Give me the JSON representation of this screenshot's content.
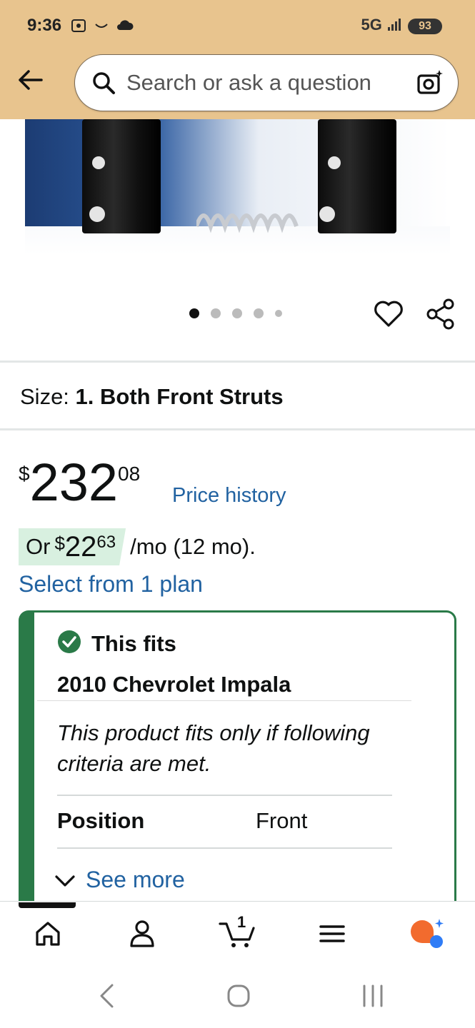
{
  "status_bar": {
    "time": "9:36",
    "network": "5G",
    "battery": "93"
  },
  "header": {
    "search_placeholder": "Search or ask a question"
  },
  "product": {
    "image_dots": {
      "count": 5,
      "active_index": 0
    },
    "size_label": "Size:",
    "size_value": "1. Both Front Struts",
    "price": {
      "currency": "$",
      "whole": "232",
      "fraction": "08",
      "history_link": "Price history"
    },
    "monthly": {
      "or": "Or",
      "currency": "$",
      "whole": "22",
      "fraction": "63",
      "rest": "/mo (12 mo)."
    },
    "select_plan": "Select from 1 plan"
  },
  "fit": {
    "title": "This fits",
    "vehicle": "2010 Chevrolet Impala",
    "criteria_text": "This product fits only if following criteria are met.",
    "position_label": "Position",
    "position_value": "Front",
    "see_more": "See more"
  },
  "bottom_nav": {
    "cart_count": "1",
    "items": [
      "home-icon",
      "account-icon",
      "cart-icon",
      "menu-icon",
      "rufus-icon"
    ]
  },
  "colors": {
    "header_bg": "#e8c48e",
    "link": "#2162a1",
    "fit_green": "#2a7a48",
    "monthly_highlight": "#d8f0e0"
  }
}
